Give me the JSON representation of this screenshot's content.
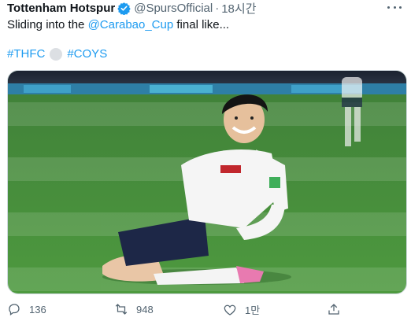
{
  "tweet": {
    "display_name": "Tottenham Hotspur",
    "handle": "@SpursOfficial",
    "separator": "·",
    "time": "18시간",
    "text_before": "Sliding into the ",
    "mention": "@Carabao_Cup",
    "text_after": " final like...",
    "hashtag_1": "#THFC",
    "hashtag_2": "#COYS"
  },
  "actions": {
    "reply_count": "136",
    "retweet_count": "948",
    "like_count": "1만"
  },
  "colors": {
    "accent": "#1d9bf0",
    "text": "#0f1419",
    "muted": "#536471"
  },
  "icons": [
    "verified-icon",
    "more-icon",
    "reply-icon",
    "retweet-icon",
    "like-icon",
    "share-icon"
  ]
}
